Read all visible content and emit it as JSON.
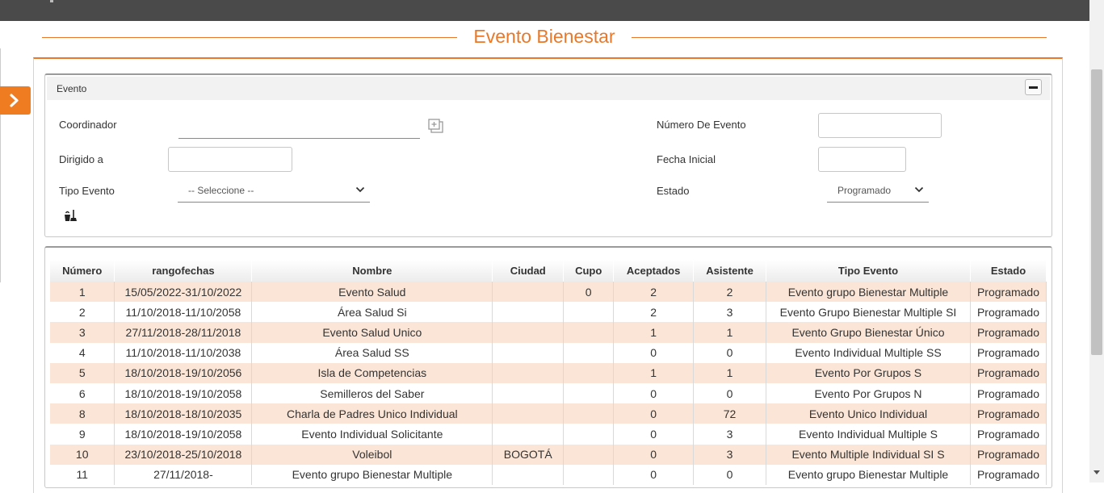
{
  "page": {
    "title": "Evento Bienestar",
    "panel_title": "Evento"
  },
  "icons": {
    "side_toggle": "chevron-right-icon",
    "lookup": "lookup-add-icon",
    "clear": "clean-broom-icon",
    "collapse": "minus-icon",
    "select": "chevron-down-icon"
  },
  "colors": {
    "accent": "#e8792b",
    "row_highlight": "#fbe5d6",
    "topbar": "#4a4a4a"
  },
  "form": {
    "coordinador_label": "Coordinador",
    "coordinador_value": "",
    "dirigido_label": "Dirigido a",
    "dirigido_value": "",
    "tipo_evento_label": "Tipo Evento",
    "tipo_evento_value": "-- Seleccione --",
    "numero_evento_label": "Número De Evento",
    "numero_evento_value": "",
    "fecha_inicial_label": "Fecha Inicial",
    "fecha_inicial_value": "",
    "estado_label": "Estado",
    "estado_value": "Programado"
  },
  "grid": {
    "columns": [
      "Número",
      "rangofechas",
      "Nombre",
      "Ciudad",
      "Cupo",
      "Aceptados",
      "Asistente",
      "Tipo Evento",
      "Estado"
    ],
    "rows": [
      [
        "1",
        "15/05/2022-31/10/2022",
        "Evento Salud",
        "",
        "0",
        "2",
        "2",
        "Evento grupo Bienestar Multiple",
        "Programado"
      ],
      [
        "2",
        "11/10/2018-11/10/2058",
        "Área Salud Si",
        "",
        "",
        "2",
        "3",
        "Evento Grupo Bienestar Multiple SI",
        "Programado"
      ],
      [
        "3",
        "27/11/2018-28/11/2018",
        "Evento Salud Unico",
        "",
        "",
        "1",
        "1",
        "Evento Grupo Bienestar Único",
        "Programado"
      ],
      [
        "4",
        "11/10/2018-11/10/2038",
        "Área Salud SS",
        "",
        "",
        "0",
        "0",
        "Evento Individual Multiple SS",
        "Programado"
      ],
      [
        "5",
        "18/10/2018-19/10/2056",
        "Isla de Competencias",
        "",
        "",
        "1",
        "1",
        "Evento Por Grupos S",
        "Programado"
      ],
      [
        "6",
        "18/10/2018-19/10/2058",
        "Semilleros del Saber",
        "",
        "",
        "0",
        "0",
        "Evento Por Grupos N",
        "Programado"
      ],
      [
        "8",
        "18/10/2018-18/10/2035",
        "Charla de Padres Unico Individual",
        "",
        "",
        "0",
        "72",
        "Evento Unico Individual",
        "Programado"
      ],
      [
        "9",
        "18/10/2018-19/10/2058",
        "Evento Individual Solicitante",
        "",
        "",
        "0",
        "3",
        "Evento Individual Multiple S",
        "Programado"
      ],
      [
        "10",
        "23/10/2018-25/10/2018",
        "Voleibol",
        "BOGOTÁ",
        "",
        "0",
        "3",
        "Evento Multiple Individual SI S",
        "Programado"
      ],
      [
        "11",
        "27/11/2018-",
        "Evento grupo Bienestar Multiple",
        "",
        "",
        "0",
        "0",
        "Evento grupo Bienestar Multiple",
        "Programado"
      ]
    ]
  }
}
